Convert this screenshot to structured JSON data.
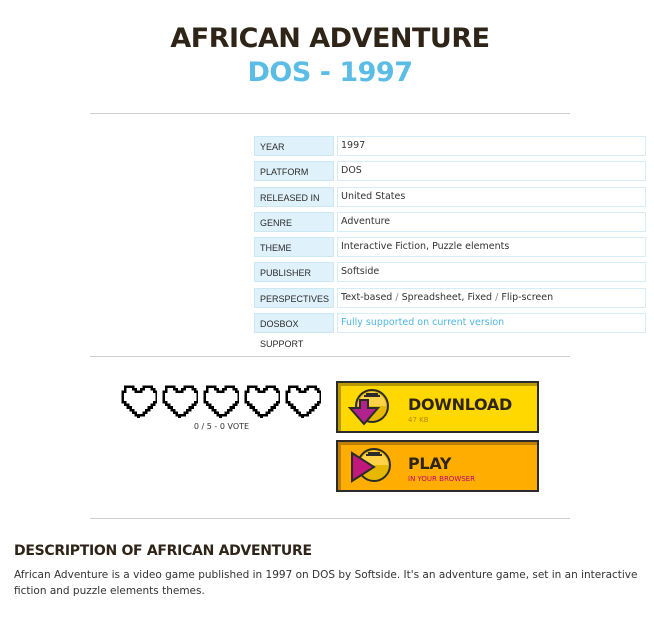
{
  "header": {
    "title": "AFRICAN ADVENTURE",
    "subtitle": "DOS - 1997"
  },
  "info": {
    "rows": [
      {
        "label": "YEAR",
        "value": "1997"
      },
      {
        "label": "PLATFORM",
        "value": "DOS"
      },
      {
        "label": "RELEASED IN",
        "value": "United States"
      },
      {
        "label": "GENRE",
        "value": "Adventure"
      },
      {
        "label": "THEME",
        "value_parts": [
          "Interactive Fiction",
          "Puzzle elements"
        ],
        "separator": ","
      },
      {
        "label": "PUBLISHER",
        "value": "Softside"
      },
      {
        "label": "PERSPECTIVES",
        "value_parts": [
          "Text-based",
          "Spreadsheet, Fixed",
          "Flip-screen"
        ],
        "separator": "/"
      },
      {
        "label": "DOSBOX SUPPORT",
        "value": "Fully supported on current version"
      }
    ]
  },
  "rating": {
    "hearts": 5,
    "filled": 0,
    "vote_text": "0 / 5 - 0 VOTE"
  },
  "buttons": {
    "download": {
      "label": "DOWNLOAD",
      "sub": "47 KB"
    },
    "play": {
      "label": "PLAY",
      "sub": "IN YOUR BROWSER"
    }
  },
  "description": {
    "title": "DESCRIPTION OF AFRICAN ADVENTURE",
    "text": "African Adventure is a video game published in 1997 on DOS by Softside. It's an adventure game, set in an interactive fiction and puzzle elements themes."
  },
  "colors": {
    "title": "#2f2418",
    "accent": "#5bbde6",
    "download_bg": "#ffd800",
    "play_bg": "#ffae00"
  }
}
